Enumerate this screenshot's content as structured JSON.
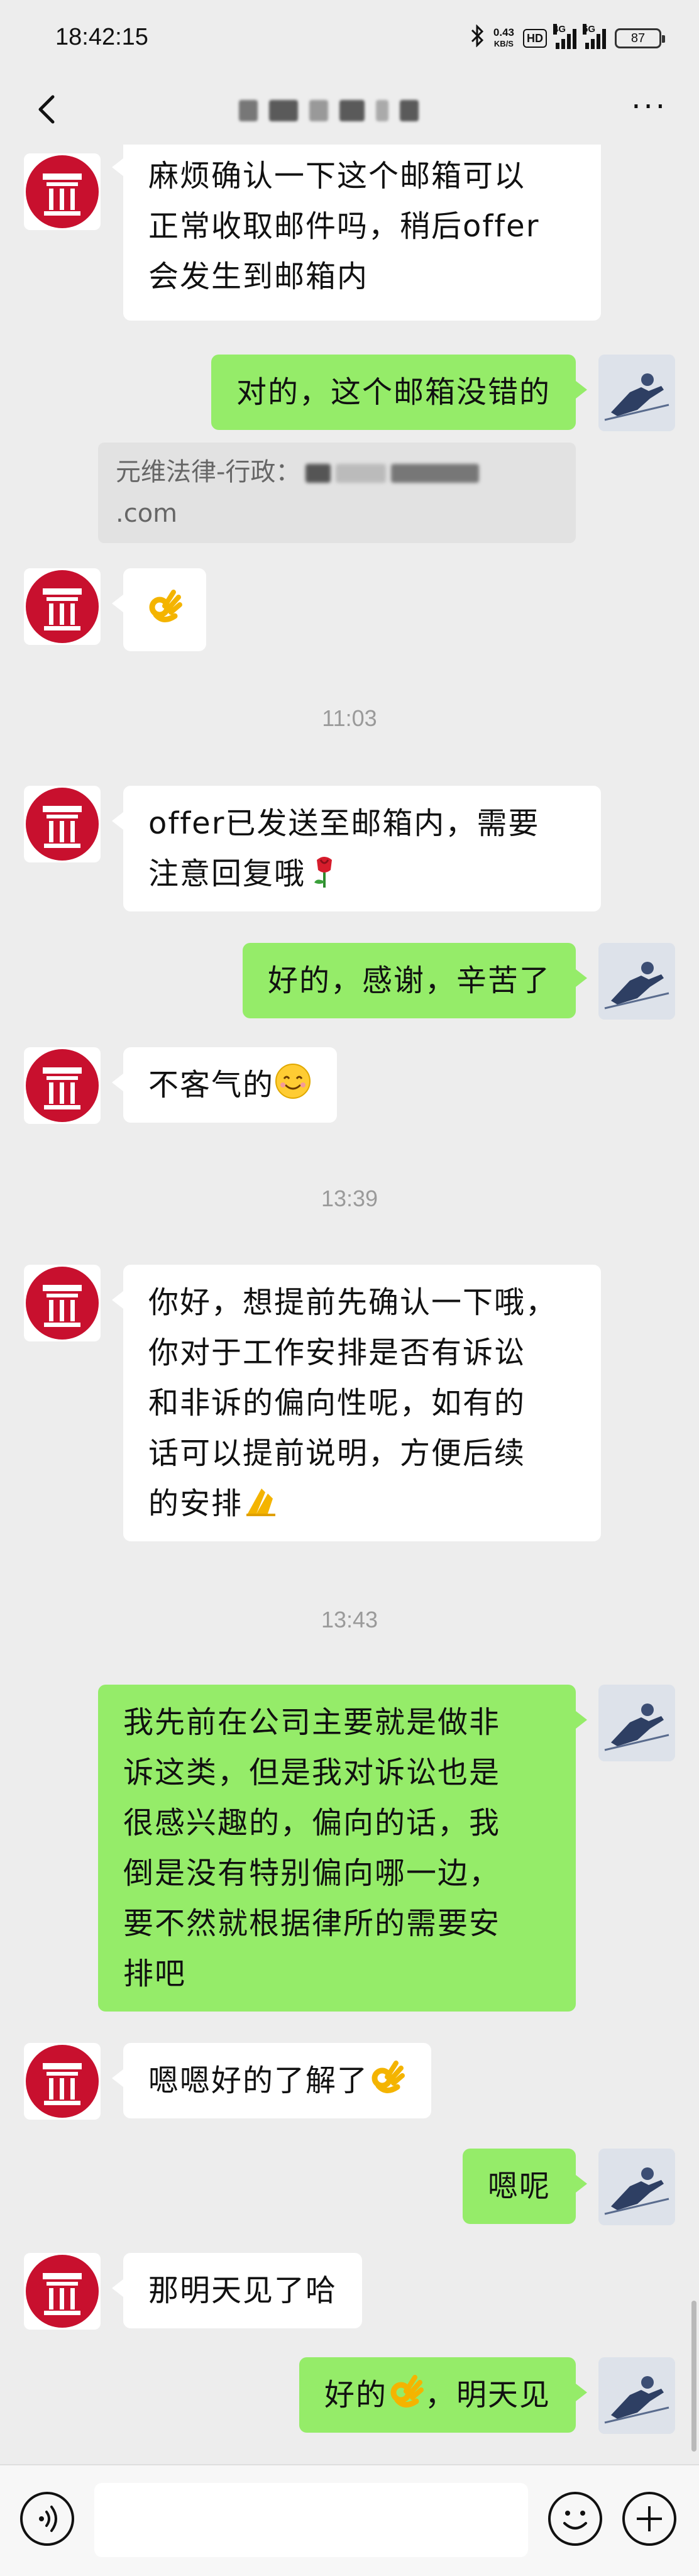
{
  "status_bar": {
    "time": "18:42:15",
    "speed_value": "0.43",
    "speed_unit": "KB/S",
    "hd_badge": "HD",
    "signal1_label": "4G",
    "signal2_label": "5G",
    "battery": "87"
  },
  "header": {
    "more_label": "···"
  },
  "chat": {
    "msg1": [
      "麻烦确认一下这个邮箱可以",
      "正常收取邮件吗，稍后offer",
      "会发生到邮箱内"
    ],
    "msg2": "对的，这个邮箱没错的",
    "quote_line1": "元维法律-行政：",
    "quote_line2": ".com",
    "msg3_emoji": "ok-hand",
    "time1": "11:03",
    "msg4": [
      "offer已发送至邮箱内，需要",
      "注意回复哦"
    ],
    "msg5": "好的，感谢，辛苦了",
    "msg6": "不客气的",
    "time2": "13:39",
    "msg7": [
      "你好，想提前先确认一下哦，",
      "你对于工作安排是否有诉讼",
      "和非诉的偏向性呢，如有的",
      "话可以提前说明，方便后续",
      "的安排"
    ],
    "time3": "13:43",
    "msg8": [
      "我先前在公司主要就是做非",
      "诉这类，但是我对诉讼也是",
      "很感兴趣的，偏向的话，我",
      "倒是没有特别偏向哪一边，",
      "要不然就根据律所的需要安",
      "排吧"
    ],
    "msg9": "嗯嗯好的了解了",
    "msg10": "嗯呢",
    "msg11": "那明天见了哈",
    "msg12_part1": "好的",
    "msg12_part2": "，明天见"
  },
  "colors": {
    "background": "#ededed",
    "bubble_self": "#95ec69",
    "bubble_other": "#ffffff",
    "logo_red": "#c8102e",
    "timestamp": "#9a9a9a"
  }
}
